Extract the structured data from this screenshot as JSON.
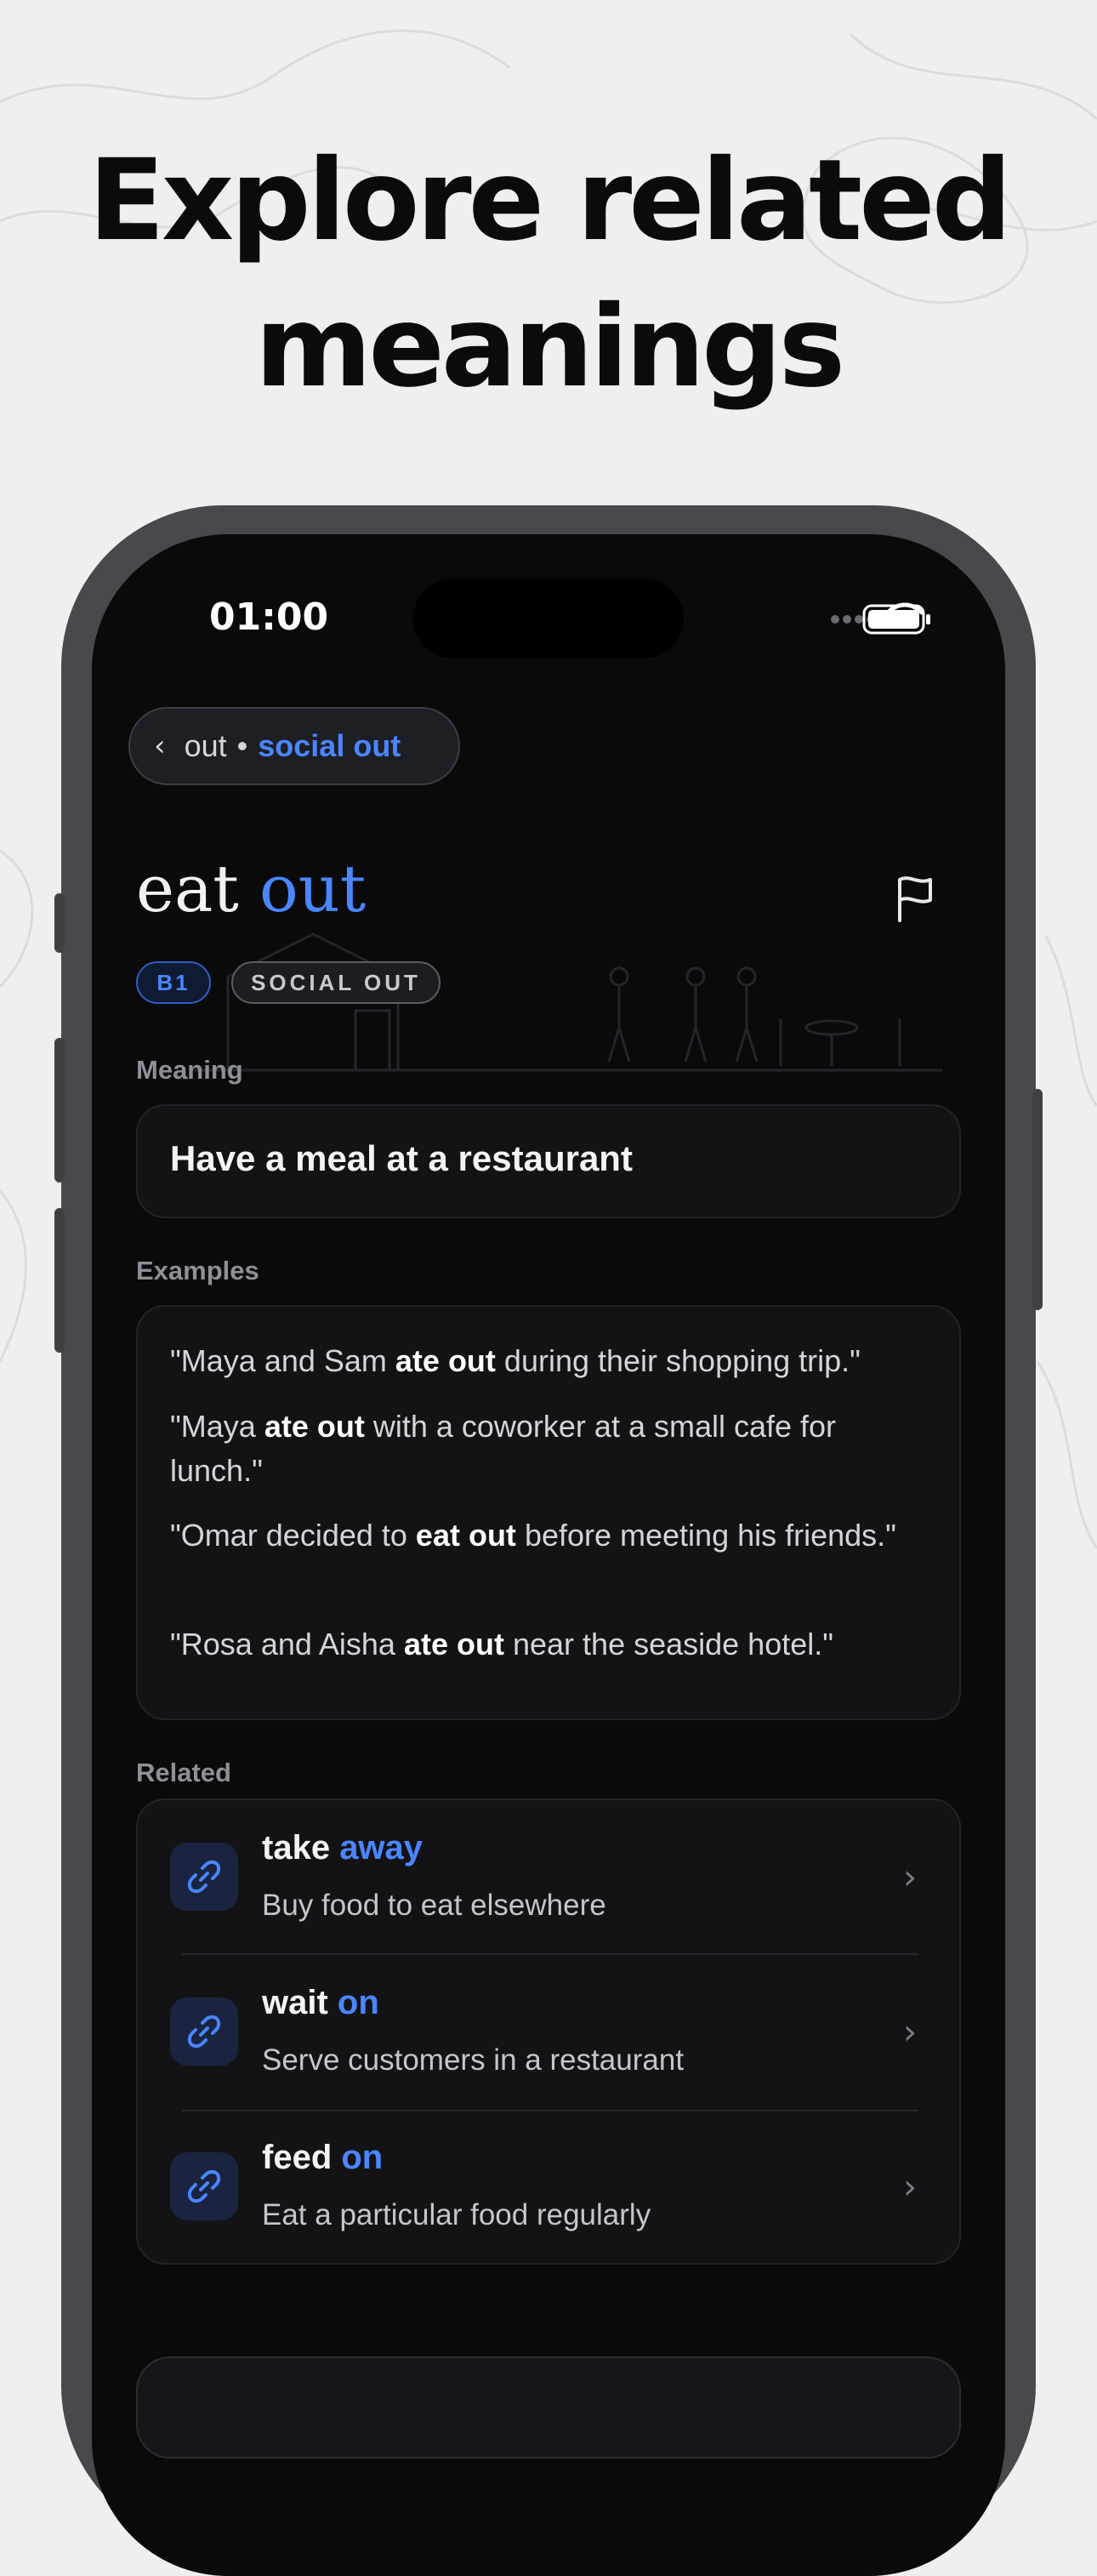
{
  "headline": {
    "line1": "Explore related",
    "line2": "meanings"
  },
  "status_bar": {
    "time": "01:00",
    "icons": [
      "signal-icon",
      "wifi-icon",
      "battery-icon"
    ]
  },
  "breadcrumb": {
    "parent": "out",
    "separator": "•",
    "current": "social out"
  },
  "entry": {
    "verb": "eat",
    "particle": "out",
    "level": "B1",
    "category": "SOCIAL OUT"
  },
  "meaning": {
    "label": "Meaning",
    "text": "Have a meal at a restaurant"
  },
  "examples": {
    "label": "Examples",
    "items": [
      {
        "before": "\"Maya and Sam ",
        "bold": "ate out",
        "after": " during their shopping trip.\""
      },
      {
        "before": "\"Maya ",
        "bold": "ate out",
        "after": " with a coworker at a small cafe for lunch.\""
      },
      {
        "before": "\"Omar decided to ",
        "bold": "eat out",
        "after": " before meeting his friends.\""
      },
      {
        "before": "\"Rosa and Aisha ",
        "bold": "ate out",
        "after": " near the seaside hotel.\""
      }
    ]
  },
  "related": {
    "label": "Related",
    "items": [
      {
        "verb": "take",
        "particle": "away",
        "definition": "Buy food to eat elsewhere"
      },
      {
        "verb": "wait",
        "particle": "on",
        "definition": "Serve customers in a restaurant"
      },
      {
        "verb": "feed",
        "particle": "on",
        "definition": "Eat a particular food regularly"
      }
    ]
  },
  "colors": {
    "accent": "#4a86ff",
    "screen_bg": "#0a0a0b",
    "card_bg": "#131315"
  }
}
